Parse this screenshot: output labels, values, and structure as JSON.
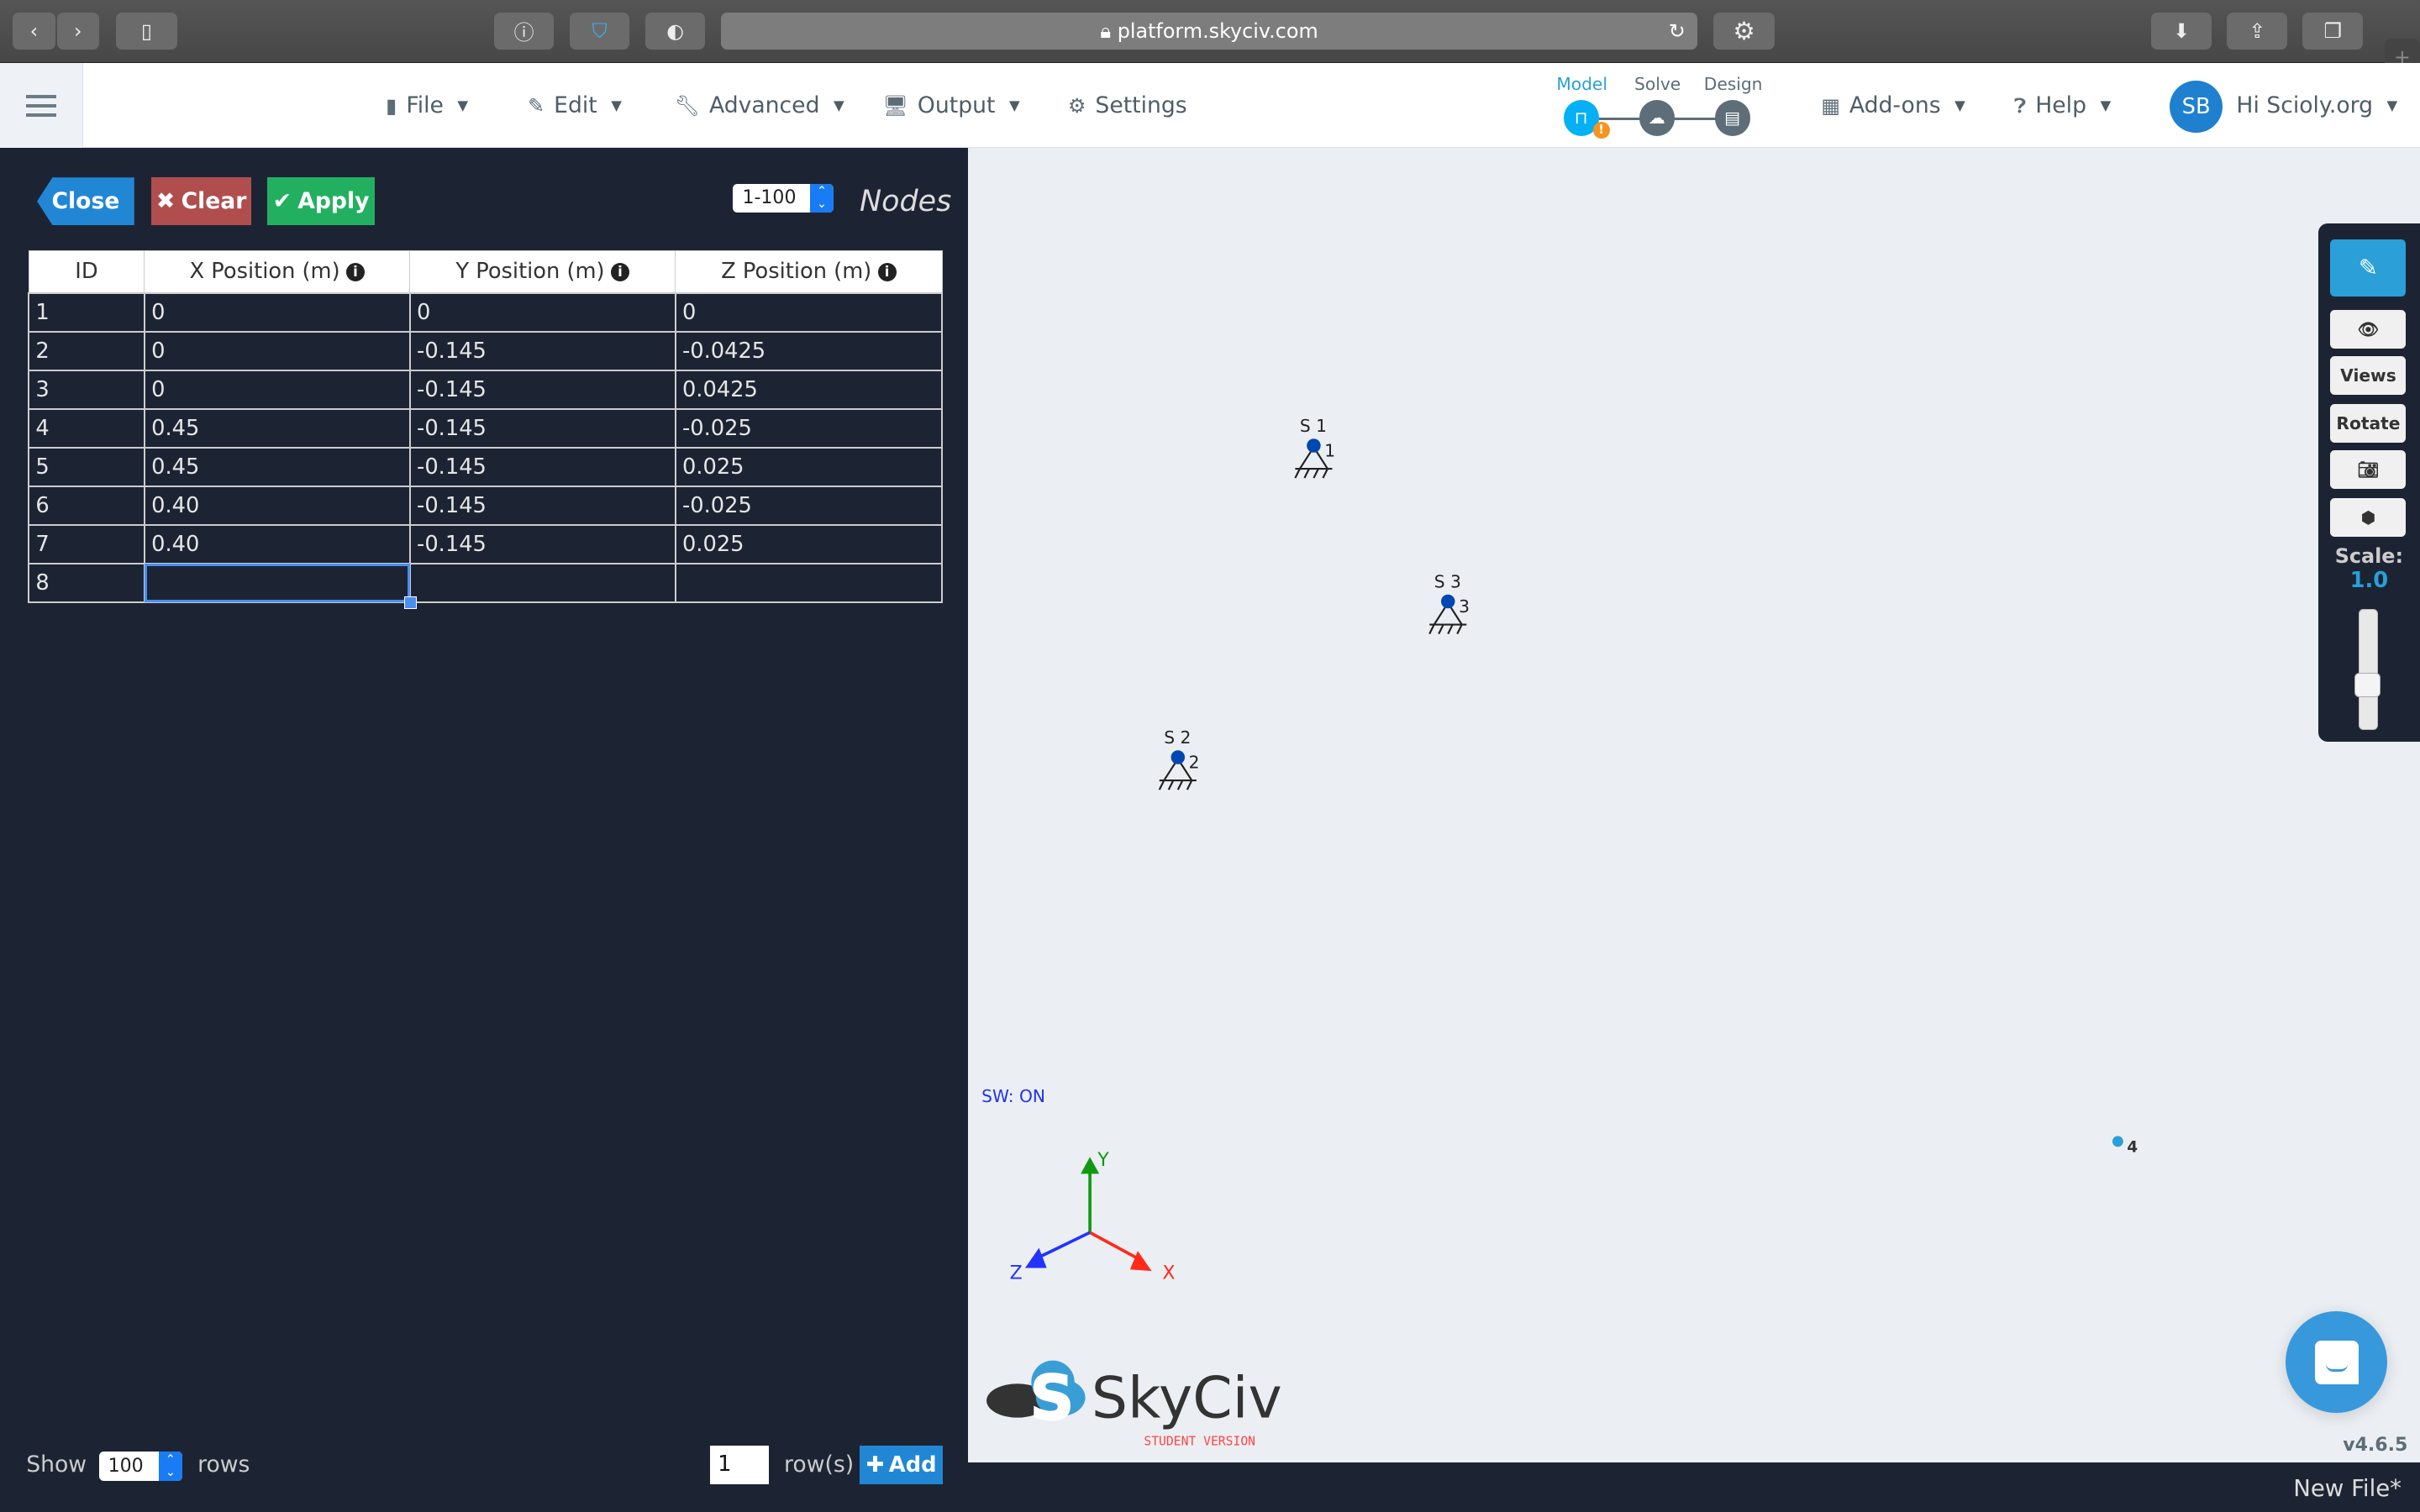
{
  "browser": {
    "url": "platform.skyciv.com"
  },
  "header": {
    "menu": [
      {
        "label": "File"
      },
      {
        "label": "Edit"
      },
      {
        "label": "Advanced"
      },
      {
        "label": "Output"
      },
      {
        "label": "Settings"
      }
    ],
    "steps": [
      {
        "label": "Model"
      },
      {
        "label": "Solve"
      },
      {
        "label": "Design"
      }
    ],
    "addons": "Add-ons",
    "help": "Help",
    "avatar": "SB",
    "user": "Hi Scioly.org"
  },
  "panel": {
    "close": "Close",
    "clear": "Clear",
    "apply": "Apply",
    "range": "1-100",
    "title": "Nodes",
    "columns": [
      "ID",
      "X Position (m)",
      "Y Position (m)",
      "Z Position (m)"
    ],
    "rows": [
      [
        "1",
        "0",
        "0",
        "0"
      ],
      [
        "2",
        "0",
        "-0.145",
        "-0.0425"
      ],
      [
        "3",
        "0",
        "-0.145",
        "0.0425"
      ],
      [
        "4",
        "0.45",
        "-0.145",
        "-0.025"
      ],
      [
        "5",
        "0.45",
        "-0.145",
        "0.025"
      ],
      [
        "6",
        "0.40",
        "-0.145",
        "-0.025"
      ],
      [
        "7",
        "0.40",
        "-0.145",
        "0.025"
      ],
      [
        "8",
        "",
        "",
        ""
      ]
    ],
    "show": "Show",
    "show_value": "100",
    "rows_label": "rows",
    "add_count": "1",
    "rowsuffix": "row(s)",
    "add": "Add"
  },
  "viewport": {
    "sw": "SW: ON",
    "supports": [
      {
        "label": "S 1",
        "node": "1"
      },
      {
        "label": "S 2",
        "node": "2"
      },
      {
        "label": "S 3",
        "node": "3"
      }
    ],
    "free_node": "4",
    "axes": {
      "x": "X",
      "y": "Y",
      "z": "Z"
    },
    "logo": "SkyCiv",
    "logo_sub": "STUDENT VERSION",
    "version": "v4.6.5",
    "file": "New File*"
  },
  "toolbar": {
    "views": "Views",
    "rotate": "Rotate",
    "scale_label": "Scale:",
    "scale": "1.0",
    "scale_fraction": 0.35
  },
  "colors": {
    "accent": "#2187d4",
    "clear": "#b04e4e",
    "apply": "#22b060",
    "panel": "#1c2434"
  }
}
